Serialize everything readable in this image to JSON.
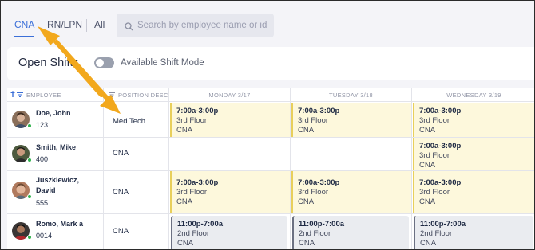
{
  "tabs": [
    {
      "label": "CNA",
      "active": true
    },
    {
      "label": "RN/LPN",
      "active": false
    },
    {
      "label": "All",
      "active": false
    }
  ],
  "search": {
    "placeholder": "Search by employee name or id",
    "icon": "search-icon"
  },
  "open_shifts": {
    "title": "Open Shifts",
    "toggle_label": "Available Shift Mode",
    "toggle_on": false
  },
  "columns": {
    "employee": "EMPLOYEE",
    "position": "POSITION DESC",
    "days": [
      "MONDAY 3/17",
      "TUESDAY 3/18",
      "WEDNESDAY 3/19"
    ]
  },
  "rows": [
    {
      "name_line1": "Doe, John",
      "name_line2": "",
      "id": "123",
      "position": "Med Tech",
      "avatar_color": "#8a6f5a",
      "shifts": [
        {
          "time": "7:00a-3:00p",
          "location": "3rd Floor",
          "role": "CNA",
          "kind": "day"
        },
        {
          "time": "7:00a-3:00p",
          "location": "3rd Floor",
          "role": "CNA",
          "kind": "day"
        },
        {
          "time": "7:00a-3:00p",
          "location": "3rd Floor",
          "role": "CNA",
          "kind": "day"
        }
      ]
    },
    {
      "name_line1": "Smith, Mike",
      "name_line2": "",
      "id": "400",
      "position": "CNA",
      "avatar_color": "#4d5a3e",
      "shifts": [
        null,
        null,
        {
          "time": "7:00a-3:00p",
          "location": "3rd Floor",
          "role": "CNA",
          "kind": "day"
        }
      ]
    },
    {
      "name_line1": "Juszkiewicz,",
      "name_line2": "David",
      "id": "555",
      "position": "CNA",
      "avatar_color": "#b07a5e",
      "shifts": [
        {
          "time": "7:00a-3:00p",
          "location": "3rd Floor",
          "role": "CNA",
          "kind": "day"
        },
        {
          "time": "7:00a-3:00p",
          "location": "3rd Floor",
          "role": "CNA",
          "kind": "day"
        },
        {
          "time": "7:00a-3:00p",
          "location": "3rd Floor",
          "role": "CNA",
          "kind": "day"
        }
      ]
    },
    {
      "name_line1": "Romo, Mark a",
      "name_line2": "",
      "id": "0014",
      "position": "CNA",
      "avatar_color": "#3a3534",
      "shifts": [
        {
          "time": "11:00p-7:00a",
          "location": "2nd Floor",
          "role": "CNA",
          "kind": "night"
        },
        {
          "time": "11:00p-7:00a",
          "location": "2nd Floor",
          "role": "CNA",
          "kind": "night"
        },
        {
          "time": "11:00p-7:00a",
          "location": "2nd Floor",
          "role": "CNA",
          "kind": "night"
        }
      ]
    }
  ],
  "colors": {
    "accent": "#3b6fd8",
    "day_shift": "#fdf8dc",
    "night_shift": "#eaecf0",
    "status_online": "#2fb24c",
    "annotation_arrow": "#f2a81d"
  }
}
